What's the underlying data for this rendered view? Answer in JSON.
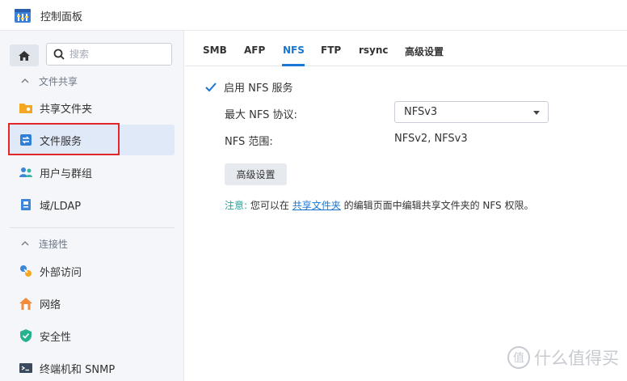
{
  "window": {
    "title": "控制面板"
  },
  "sidebar": {
    "search_placeholder": "搜索",
    "sections": [
      {
        "title": "文件共享",
        "items": [
          {
            "label": "共享文件夹",
            "icon": "shared-folder-icon",
            "active": false
          },
          {
            "label": "文件服务",
            "icon": "file-services-icon",
            "active": true
          },
          {
            "label": "用户与群组",
            "icon": "users-icon",
            "active": false
          },
          {
            "label": "域/LDAP",
            "icon": "domain-icon",
            "active": false
          }
        ]
      },
      {
        "title": "连接性",
        "items": [
          {
            "label": "外部访问",
            "icon": "external-access-icon",
            "active": false
          },
          {
            "label": "网络",
            "icon": "network-icon",
            "active": false
          },
          {
            "label": "安全性",
            "icon": "security-icon",
            "active": false
          },
          {
            "label": "终端机和 SNMP",
            "icon": "terminal-icon",
            "active": false
          }
        ]
      }
    ]
  },
  "tabs": [
    "SMB",
    "AFP",
    "NFS",
    "FTP",
    "rsync",
    "高级设置"
  ],
  "active_tab": "NFS",
  "nfs": {
    "enable_label": "启用 NFS 服务",
    "enabled": true,
    "max_protocol_label": "最大 NFS 协议:",
    "max_protocol_value": "NFSv3",
    "range_label": "NFS 范围:",
    "range_value": "NFSv2, NFSv3",
    "advanced_button": "高级设置",
    "note_label": "注意:",
    "note_before": "您可以在",
    "note_link": "共享文件夹",
    "note_after": "的编辑页面中编辑共享文件夹的 NFS 权限。"
  },
  "watermark": {
    "text": "什么值得买",
    "glyph": "值"
  },
  "colors": {
    "accent": "#1a77d3",
    "note_label": "#2aa39a",
    "highlight": "#e2262a"
  }
}
